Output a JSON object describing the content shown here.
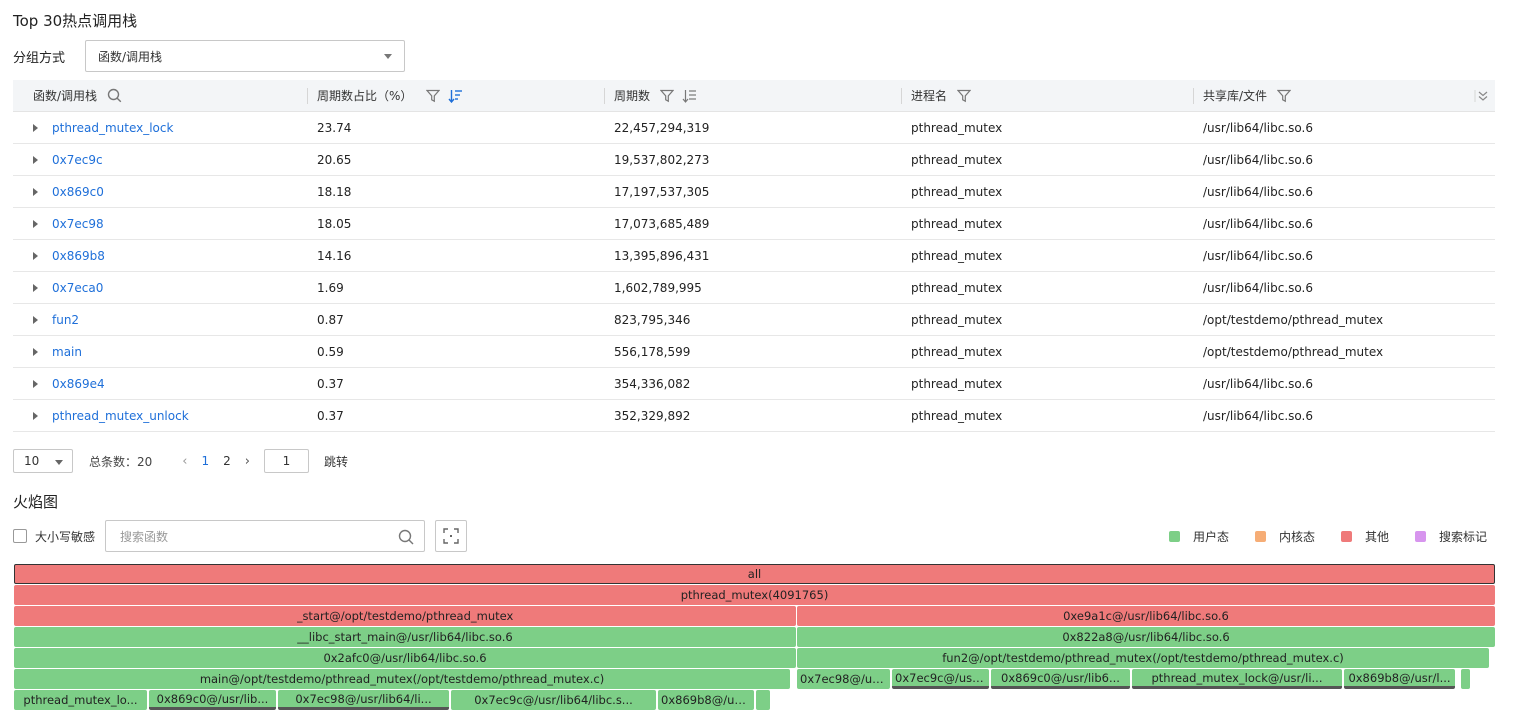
{
  "hot_stack": {
    "title": "Top 30热点调用栈",
    "group_label": "分组方式",
    "group_value": "函数/调用栈",
    "columns": [
      "函数/调用栈",
      "周期数占比（%）",
      "周期数",
      "进程名",
      "共享库/文件"
    ],
    "rows": [
      {
        "func": "pthread_mutex_lock",
        "pct": "23.74",
        "cycles": "22,457,294,319",
        "process": "pthread_mutex",
        "lib": "/usr/lib64/libc.so.6"
      },
      {
        "func": "0x7ec9c",
        "pct": "20.65",
        "cycles": "19,537,802,273",
        "process": "pthread_mutex",
        "lib": "/usr/lib64/libc.so.6"
      },
      {
        "func": "0x869c0",
        "pct": "18.18",
        "cycles": "17,197,537,305",
        "process": "pthread_mutex",
        "lib": "/usr/lib64/libc.so.6"
      },
      {
        "func": "0x7ec98",
        "pct": "18.05",
        "cycles": "17,073,685,489",
        "process": "pthread_mutex",
        "lib": "/usr/lib64/libc.so.6"
      },
      {
        "func": "0x869b8",
        "pct": "14.16",
        "cycles": "13,395,896,431",
        "process": "pthread_mutex",
        "lib": "/usr/lib64/libc.so.6"
      },
      {
        "func": "0x7eca0",
        "pct": "1.69",
        "cycles": "1,602,789,995",
        "process": "pthread_mutex",
        "lib": "/usr/lib64/libc.so.6"
      },
      {
        "func": "fun2",
        "pct": "0.87",
        "cycles": "823,795,346",
        "process": "pthread_mutex",
        "lib": "/opt/testdemo/pthread_mutex"
      },
      {
        "func": "main",
        "pct": "0.59",
        "cycles": "556,178,599",
        "process": "pthread_mutex",
        "lib": "/opt/testdemo/pthread_mutex"
      },
      {
        "func": "0x869e4",
        "pct": "0.37",
        "cycles": "354,336,082",
        "process": "pthread_mutex",
        "lib": "/usr/lib64/libc.so.6"
      },
      {
        "func": "pthread_mutex_unlock",
        "pct": "0.37",
        "cycles": "352,329,892",
        "process": "pthread_mutex",
        "lib": "/usr/lib64/libc.so.6"
      }
    ]
  },
  "pagination": {
    "page_size": "10",
    "total": "总条数：20",
    "pages": [
      "1",
      "2"
    ],
    "jump_value": "1",
    "jump_label": "跳转"
  },
  "flamegraph": {
    "title": "火焰图",
    "case_sensitive_label": "大小写敏感",
    "search_placeholder": "搜索函数",
    "legend": [
      {
        "label": "用户态",
        "color": "#7dcf87"
      },
      {
        "label": "内核态",
        "color": "#f6ad76"
      },
      {
        "label": "其他",
        "color": "#ef7a7a"
      },
      {
        "label": "搜索标记",
        "color": "#d795ee"
      }
    ],
    "frames": [
      "all",
      "pthread_mutex(4091765)",
      "_start@/opt/testdemo/pthread_mutex",
      "0xe9a1c@/usr/lib64/libc.so.6",
      "__libc_start_main@/usr/lib64/libc.so.6",
      "0x822a8@/usr/lib64/libc.so.6",
      "0x2afc0@/usr/lib64/libc.so.6",
      "fun2@/opt/testdemo/pthread_mutex(/opt/testdemo/pthread_mutex.c)",
      "main@/opt/testdemo/pthread_mutex(/opt/testdemo/pthread_mutex.c)",
      "0x7ec98@/usr...",
      "0x7ec9c@/usr...",
      "0x869c0@/usr/lib6...",
      "pthread_mutex_lock@/usr/li...",
      "0x869b8@/usr/l...",
      "pthread_mutex_lo...",
      "0x869c0@/usr/lib...",
      "0x7ec98@/usr/lib64/li...",
      "0x7ec9c@/usr/lib64/libc.s...",
      "0x869b8@/us..."
    ]
  }
}
